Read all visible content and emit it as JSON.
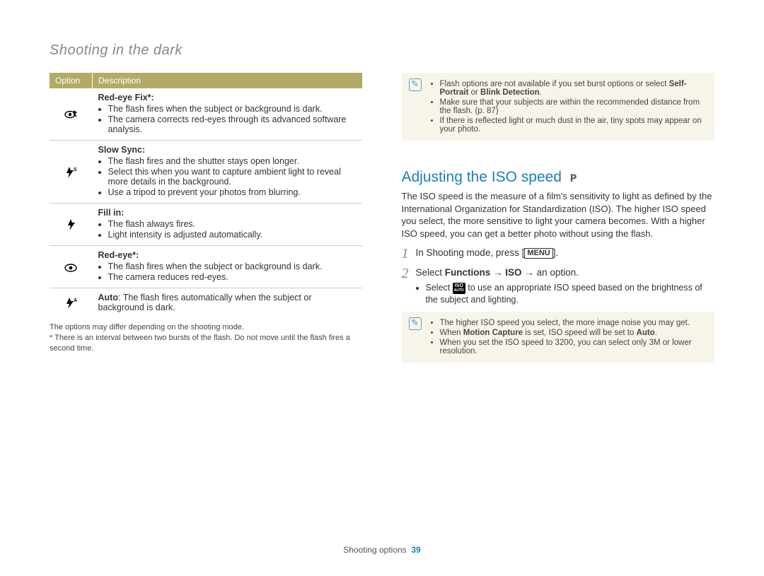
{
  "page_title": "Shooting in the dark",
  "table": {
    "headers": [
      "Option",
      "Description"
    ],
    "rows": [
      {
        "icon": "redeye-fix",
        "title": "Red-eye Fix*:",
        "bullets": [
          "The flash fires when the subject or background is dark.",
          "The camera corrects red-eyes through its advanced software analysis."
        ]
      },
      {
        "icon": "slow-sync",
        "title": "Slow Sync:",
        "bullets": [
          "The flash fires and the shutter stays open longer.",
          "Select this when you want to capture ambient light to reveal more details in the background.",
          "Use a tripod to prevent your photos from blurring."
        ]
      },
      {
        "icon": "fill-in",
        "title": "Fill in:",
        "bullets": [
          "The flash always fires.",
          "Light intensity is adjusted automatically."
        ]
      },
      {
        "icon": "redeye",
        "title": "Red-eye*:",
        "bullets": [
          "The flash fires when the subject or background is dark.",
          "The camera reduces red-eyes."
        ]
      },
      {
        "icon": "auto",
        "title_inline": "Auto",
        "text_after": ": The flash fires automatically when the subject or background is dark."
      }
    ]
  },
  "footnotes": [
    "The options may differ depending on the shooting mode.",
    "* There is an interval between two bursts of the flash. Do not move until the flash fires a second time."
  ],
  "note1": {
    "items": [
      {
        "pre": "Flash options are not available if you set burst options or select ",
        "bold": "Self-Portrait",
        "mid": " or ",
        "bold2": "Blink Detection",
        "post": "."
      },
      {
        "text": "Make sure that your subjects are within the recommended distance from the flash. (p. 87)"
      },
      {
        "text": "If there is reflected light or much dust in the air, tiny spots may appear on your photo."
      }
    ]
  },
  "section": {
    "title": "Adjusting the ISO speed",
    "mode": "P",
    "para": "The ISO speed is the measure of a film's sensitivity to light as defined by the International Organization for Standardization (ISO). The higher ISO speed you select, the more sensitive to light your camera becomes. With a higher ISO speed, you can get a better photo without using the flash.",
    "step1_pre": "In Shooting mode, press [",
    "step1_menu": "MENU",
    "step1_post": "].",
    "step2_pre": "Select ",
    "step2_b1": "Functions",
    "step2_arr1": " → ",
    "step2_b2": "ISO",
    "step2_arr2": " → an option.",
    "step2_sub_pre": "Select ",
    "step2_sub_icon": "ISO AUTO",
    "step2_sub_post": " to use an appropriate ISO speed based on the brightness of the subject and lighting."
  },
  "note2": {
    "items": [
      {
        "text": "The higher ISO speed you select, the more image noise you may get."
      },
      {
        "pre": "When ",
        "bold": "Motion Capture",
        "mid": " is set, ISO speed will be set to ",
        "bold2": "Auto",
        "post": "."
      },
      {
        "text": "When you set the ISO speed to 3200, you can select only 3M or lower resolution."
      }
    ]
  },
  "footer": {
    "label": "Shooting options",
    "page": "39"
  }
}
